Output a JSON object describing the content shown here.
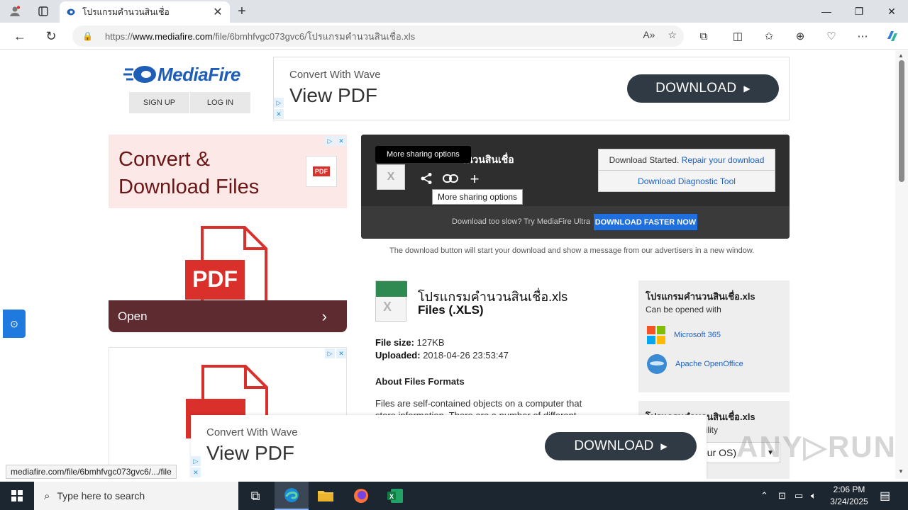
{
  "browser": {
    "tab_title": "โปรแกรมคำนวนสินเชื่อ",
    "url_prefix": "https://",
    "url_domain": "www.mediafire.com",
    "url_path": "/file/6bmhfvgc073gvc6/โปรแกรมคำนวนสินเชื่อ.xls",
    "read_aloud_label": "A»"
  },
  "header": {
    "logo_text": "MediaFire",
    "sign_up": "SIGN UP",
    "log_in": "LOG IN"
  },
  "top_ad": {
    "subtitle": "Convert With Wave",
    "title": "View PDF",
    "button": "DOWNLOAD",
    "button_arrow": "▶",
    "choice_mark": "▷",
    "close_mark": "✕"
  },
  "left_ad": {
    "headline": "Convert & Download Files",
    "pdf_label": "PDF",
    "open_label": "Open",
    "open_chevron": "›"
  },
  "download_box": {
    "file_name_partial": "ำนวนสินเชื่อ",
    "tooltip_top": "More sharing options",
    "tooltip_bottom": "More sharing options",
    "started_text": "Download Started.",
    "repair_link": "Repair your download",
    "diagnostic_link": "Download Diagnostic Tool",
    "slow_text": "Download too slow? Try MediaFire Ultra",
    "faster_button": "DOWNLOAD FASTER NOW"
  },
  "note": "The download button will start your download and show a message from our advertisers in a new window.",
  "file": {
    "name": "โปรแกรมคำนวนสินเชื่อ.xls",
    "type": "Files (.XLS)",
    "size_label": "File size:",
    "size_value": "127KB",
    "uploaded_label": "Uploaded:",
    "uploaded_value": "2018-04-26 23:53:47",
    "about_heading": "About Files Formats",
    "about_text": "Files are self-contained objects on a computer that store information. There are a number of different file"
  },
  "side_panel": {
    "title": "โปรแกรมคำนวนสินเชื่อ.xls",
    "subtitle": "Can be opened with",
    "apps": [
      "Microsoft 365",
      "Apache OpenOffice"
    ],
    "title2": "โปรแกรมคำนวนสินเชื่อ.xls",
    "compat_partial": "tibility",
    "os_partial": "our OS)"
  },
  "status_url": "mediafire.com/file/6bmhfvgc073gvc6/.../file",
  "watermark": "ANY▷RUN",
  "taskbar": {
    "search_placeholder": "Type here to search",
    "time": "2:06 PM",
    "date": "3/24/2025"
  },
  "colors": {
    "accent_blue": "#1f6fdf",
    "ad_button": "#2f3a44",
    "download_box": "#2e2e2e"
  }
}
